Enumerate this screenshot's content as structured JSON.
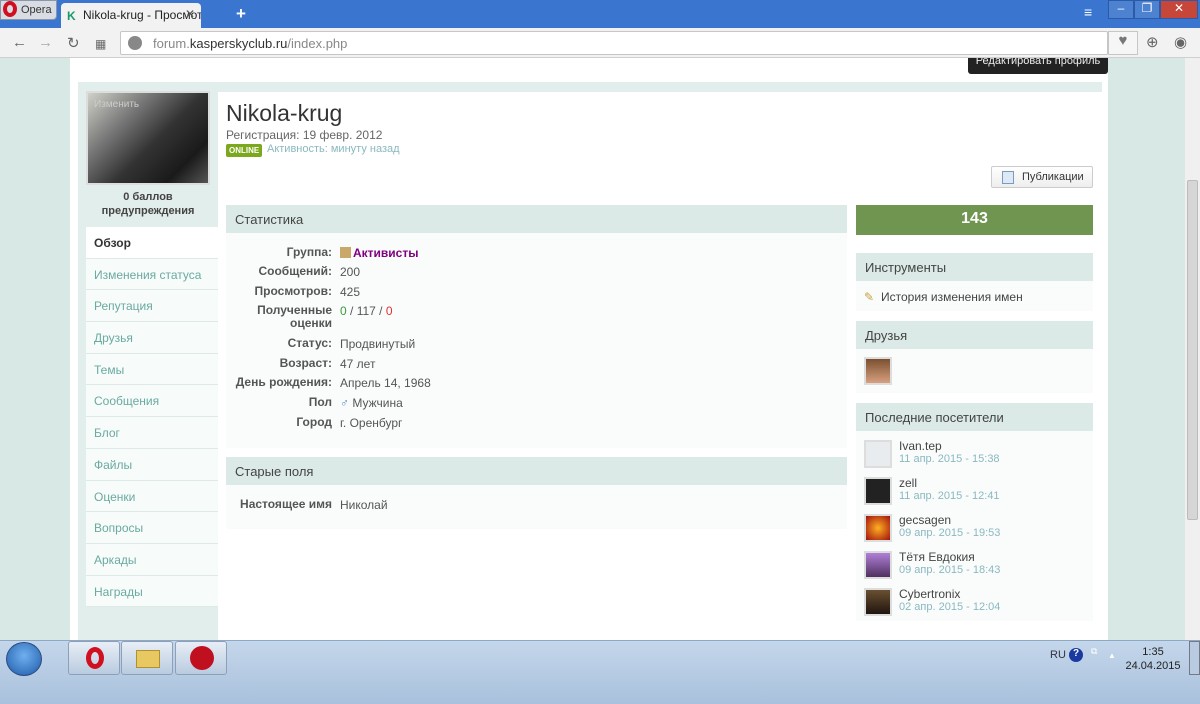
{
  "browser": {
    "app_label": "Opera",
    "tab_title": "Nikola-krug - Просмотр п",
    "url_domain_pre": "forum.",
    "url_domain": "kasperskyclub.ru",
    "url_path": "/index.php"
  },
  "profile": {
    "edit_button": "Редактировать профиль",
    "photo_change": "Изменить",
    "warn_points": "0 баллов предупреждения",
    "name": "Nikola-krug",
    "registration": "Регистрация: 19 февр. 2012",
    "online_badge": "ONLINE",
    "activity": "Активность: минуту назад",
    "publications_button": "Публикации"
  },
  "sidebar": {
    "items": [
      "Обзор",
      "Изменения статуса",
      "Репутация",
      "Друзья",
      "Темы",
      "Сообщения",
      "Блог",
      "Файлы",
      "Оценки",
      "Вопросы",
      "Аркады",
      "Награды"
    ]
  },
  "stats": {
    "title": "Статистика",
    "rows": [
      {
        "k": "Группа:",
        "v": "Активисты"
      },
      {
        "k": "Сообщений:",
        "v": "200"
      },
      {
        "k": "Просмотров:",
        "v": "425"
      },
      {
        "k": "Полученные оценки",
        "v1": "0",
        "sep1": " / ",
        "v2": "117",
        "sep2": " / ",
        "v3": "0"
      },
      {
        "k": "Статус:",
        "v": "Продвинутый"
      },
      {
        "k": "Возраст:",
        "v": "47 лет"
      },
      {
        "k": "День рождения:",
        "v": "Апрель 14, 1968"
      },
      {
        "k": "Пол",
        "v": "Мужчина"
      },
      {
        "k": "Город",
        "v": "г. Оренбург"
      }
    ]
  },
  "old_fields": {
    "title": "Старые поля",
    "k": "Настоящее имя",
    "v": "Николай"
  },
  "right": {
    "count": "143",
    "tools_title": "Инструменты",
    "tools_link": "История изменения имен",
    "friends_title": "Друзья",
    "visitors_title": "Последние посетители",
    "visitors": [
      {
        "name": "Ivan.tep",
        "date": "11 апр. 2015 - 15:38"
      },
      {
        "name": "zell",
        "date": "11 апр. 2015 - 12:41"
      },
      {
        "name": "gecsagen",
        "date": "09 апр. 2015 - 19:53"
      },
      {
        "name": "Тётя Евдокия",
        "date": "09 апр. 2015 - 18:43"
      },
      {
        "name": "Cybertronix",
        "date": "02 апр. 2015 - 12:04"
      }
    ]
  },
  "taskbar": {
    "lang": "RU",
    "time": "1:35",
    "date": "24.04.2015"
  },
  "colors": {
    "accent": "#6f9550",
    "group": "#800080",
    "positive": "#3a9a3a",
    "negative": "#e03030"
  }
}
